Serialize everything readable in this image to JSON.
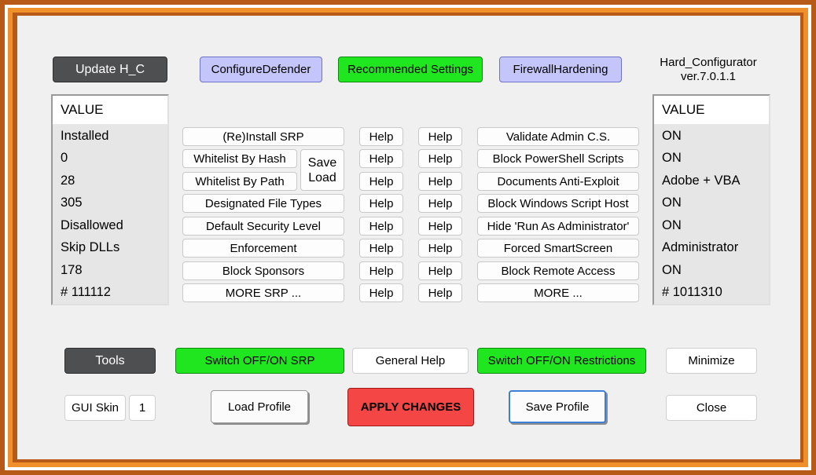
{
  "app": {
    "title": "Hard_Configurator",
    "version": "ver.7.0.1.1"
  },
  "top_buttons": {
    "update": "Update H_C",
    "configure_defender": "ConfigureDefender",
    "recommended": "Recommended Settings",
    "firewall": "FirewallHardening"
  },
  "left_list": {
    "header": "VALUE",
    "values": [
      "Installed",
      "0",
      "28",
      "305",
      "Disallowed",
      "Skip DLLs",
      "178",
      "# 111112"
    ]
  },
  "right_list": {
    "header": "VALUE",
    "values": [
      "ON",
      "ON",
      "Adobe + VBA",
      "ON",
      "ON",
      "Administrator",
      "ON",
      "# 1011310"
    ]
  },
  "srp_buttons": [
    "(Re)Install SRP",
    "Whitelist By Hash",
    "Whitelist By Path",
    "Designated File Types",
    "Default Security Level",
    "Enforcement",
    "Block Sponsors",
    "MORE SRP ..."
  ],
  "save_load": {
    "line1": "Save",
    "line2": "Load"
  },
  "help_label": "Help",
  "restriction_buttons": [
    "Validate Admin C.S.",
    "Block PowerShell Scripts",
    "Documents Anti-Exploit",
    "Block Windows Script Host",
    "Hide  'Run As Administrator'",
    "Forced SmartScreen",
    "Block Remote Access",
    "MORE ..."
  ],
  "bottom": {
    "tools": "Tools",
    "switch_srp": "Switch OFF/ON SRP",
    "general_help": "General Help",
    "switch_restrictions": "Switch OFF/ON Restrictions",
    "minimize": "Minimize",
    "gui_skin": "GUI Skin",
    "skin_number": "1",
    "load_profile": "Load Profile",
    "apply": "APPLY CHANGES",
    "save_profile": "Save Profile",
    "close": "Close"
  },
  "colors": {
    "frame": "#b75a17",
    "green": "#1fe61f",
    "lavender": "#c4c6fb",
    "red": "#f54646",
    "dark": "#4e4f51"
  }
}
